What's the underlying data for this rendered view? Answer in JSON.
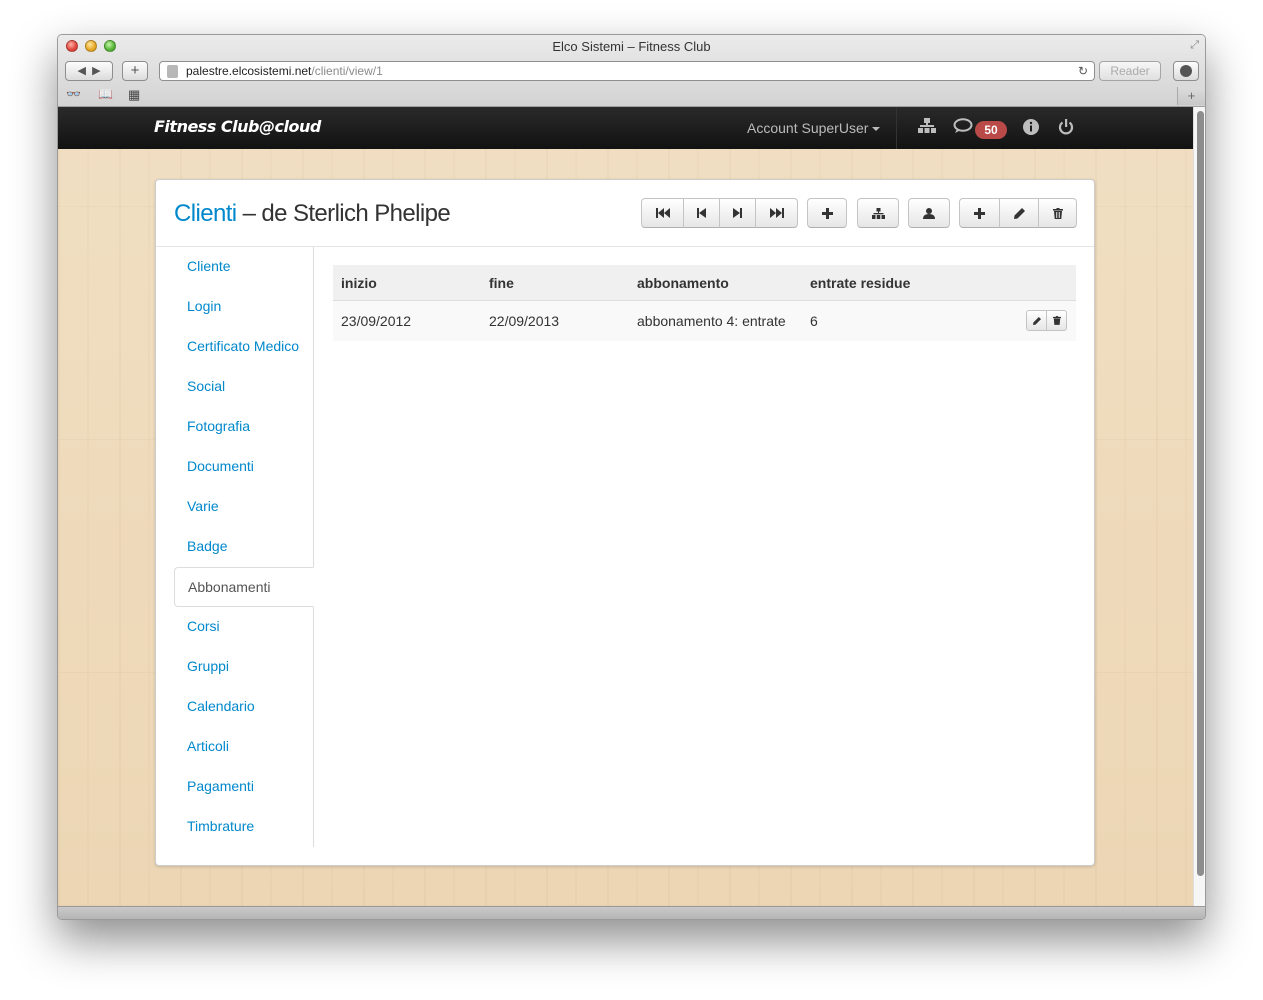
{
  "browser": {
    "window_title": "Elco Sistemi – Fitness Club",
    "url_host": "palestre.elcosistemi.net",
    "url_path": "/clienti/view/1",
    "reader_label": "Reader"
  },
  "navbar": {
    "brand": "Fitness Club@cloud",
    "account_label": "Account SuperUser",
    "messages_count": "50"
  },
  "page": {
    "breadcrumb": "Clienti",
    "separator": " – ",
    "title": "de Sterlich Phelipe"
  },
  "sidebar": {
    "items": [
      {
        "label": "Cliente"
      },
      {
        "label": "Login"
      },
      {
        "label": "Certificato Medico"
      },
      {
        "label": "Social"
      },
      {
        "label": "Fotografia"
      },
      {
        "label": "Documenti"
      },
      {
        "label": "Varie"
      },
      {
        "label": "Badge"
      },
      {
        "label": "Abbonamenti"
      },
      {
        "label": "Corsi"
      },
      {
        "label": "Gruppi"
      },
      {
        "label": "Calendario"
      },
      {
        "label": "Articoli"
      },
      {
        "label": "Pagamenti"
      },
      {
        "label": "Timbrature"
      }
    ],
    "active": "Abbonamenti"
  },
  "table": {
    "headers": [
      "inizio",
      "fine",
      "abbonamento",
      "entrate residue"
    ],
    "rows": [
      [
        "23/09/2012",
        "22/09/2013",
        "abbonamento 4: entrate",
        "6"
      ]
    ]
  },
  "colors": {
    "link": "#0088cc",
    "navbar": "#1b1b1b",
    "badge": "#b94a48"
  },
  "icons": {
    "toolbar": [
      "first-icon",
      "previous-icon",
      "next-icon",
      "last-icon",
      "plus-icon",
      "sitemap-icon",
      "user-icon",
      "plus-icon",
      "pencil-icon",
      "trash-icon"
    ],
    "navbar": [
      "sitemap-icon",
      "comment-icon",
      "info-icon",
      "power-icon"
    ]
  }
}
